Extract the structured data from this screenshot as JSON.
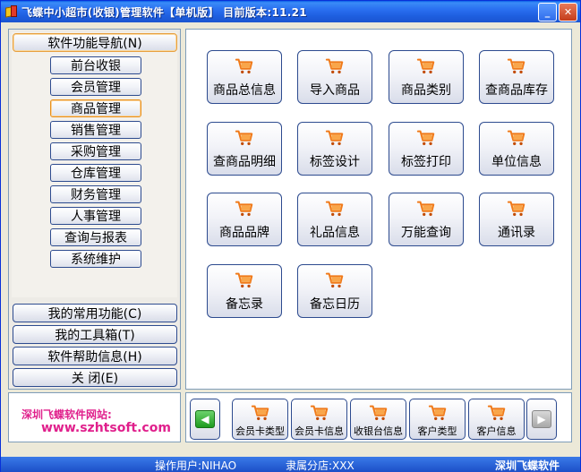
{
  "window": {
    "title": "飞蝶中小超市(收银)管理软件【单机版】 目前版本:11.21",
    "minimize": "_",
    "close": "✕"
  },
  "left_nav": {
    "header": "软件功能导航(N)",
    "items": [
      "前台收银",
      "会员管理",
      "商品管理",
      "销售管理",
      "采购管理",
      "仓库管理",
      "财务管理",
      "人事管理",
      "查询与报表",
      "系统维护"
    ],
    "active_item": "商品管理",
    "bottom_buttons": [
      "我的常用功能(C)",
      "我的工具箱(T)",
      "软件帮助信息(H)",
      "关  闭(E)"
    ]
  },
  "website": {
    "label": "深圳飞蝶软件网站:",
    "url": "www.szhtsoft.com"
  },
  "main_functions": [
    "商品总信息",
    "导入商品",
    "商品类别",
    "查商品库存",
    "查商品明细",
    "标签设计",
    "标签打印",
    "单位信息",
    "商品品牌",
    "礼品信息",
    "万能查询",
    "通讯录",
    "备忘录",
    "备忘日历"
  ],
  "bottom_toolbar": {
    "items": [
      "会员卡类型",
      "会员卡信息",
      "收银台信息",
      "客户类型",
      "客户信息"
    ],
    "prev_icon": "arrow-left-icon",
    "next_icon": "arrow-right-icon"
  },
  "status": {
    "operator": "操作用户:NIHAO",
    "branch": "隶属分店:XXX",
    "company": "深圳飞蝶软件"
  },
  "colors": {
    "title_bar": "#1E5FE0",
    "button_border": "#2D4B8F",
    "active_border": "#E8901C",
    "website_text": "#E0208C",
    "cart": "#F07A1A"
  }
}
